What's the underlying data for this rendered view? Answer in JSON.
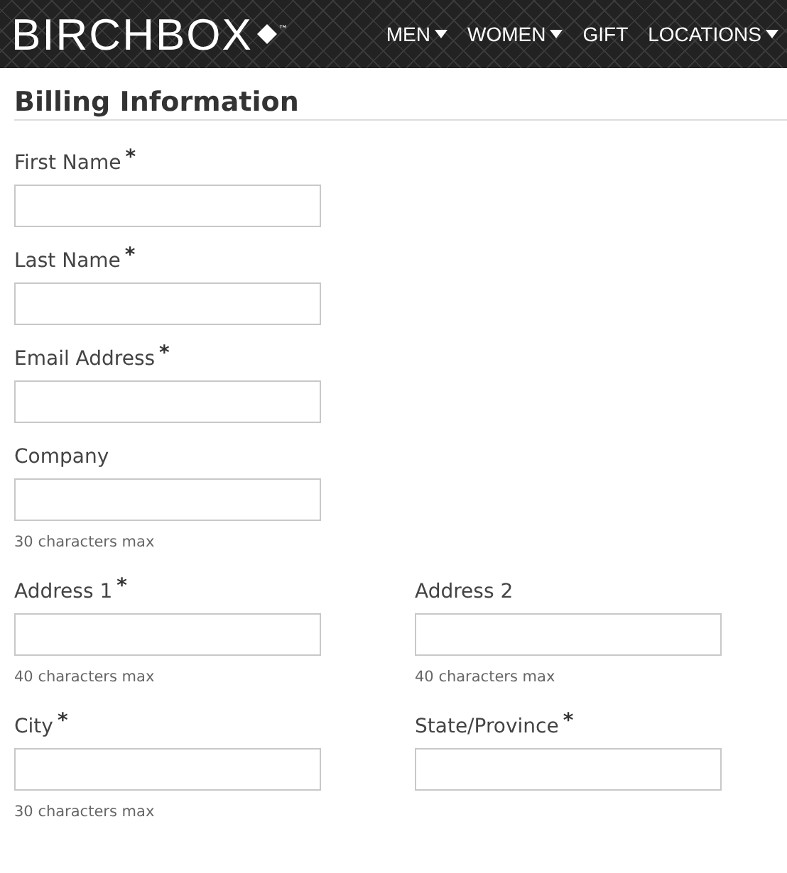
{
  "header": {
    "logo": "BIRCHBOX",
    "trademark": "™",
    "nav": [
      {
        "label": "MEN",
        "dropdown": true
      },
      {
        "label": "WOMEN",
        "dropdown": true
      },
      {
        "label": "GIFT",
        "dropdown": false
      },
      {
        "label": "LOCATIONS",
        "dropdown": true
      }
    ]
  },
  "title": "Billing Information",
  "rows": [
    {
      "fields": [
        {
          "label": "First Name",
          "required_mark": "*"
        }
      ]
    },
    {
      "fields": [
        {
          "label": "Last Name",
          "required_mark": "*"
        }
      ]
    },
    {
      "fields": [
        {
          "label": "Email Address",
          "required_mark": "*"
        }
      ]
    },
    {
      "fields": [
        {
          "label": "Company",
          "hint": "30 characters max"
        }
      ]
    },
    {
      "fields": [
        {
          "label": "Address 1",
          "required_mark": "*",
          "hint": "40 characters max"
        },
        {
          "label": "Address 2",
          "hint": "40 characters max"
        }
      ]
    },
    {
      "fields": [
        {
          "label": "City",
          "required_mark": "*",
          "hint": "30 characters max"
        },
        {
          "label": "State/Province",
          "required_mark": "*"
        }
      ]
    }
  ]
}
